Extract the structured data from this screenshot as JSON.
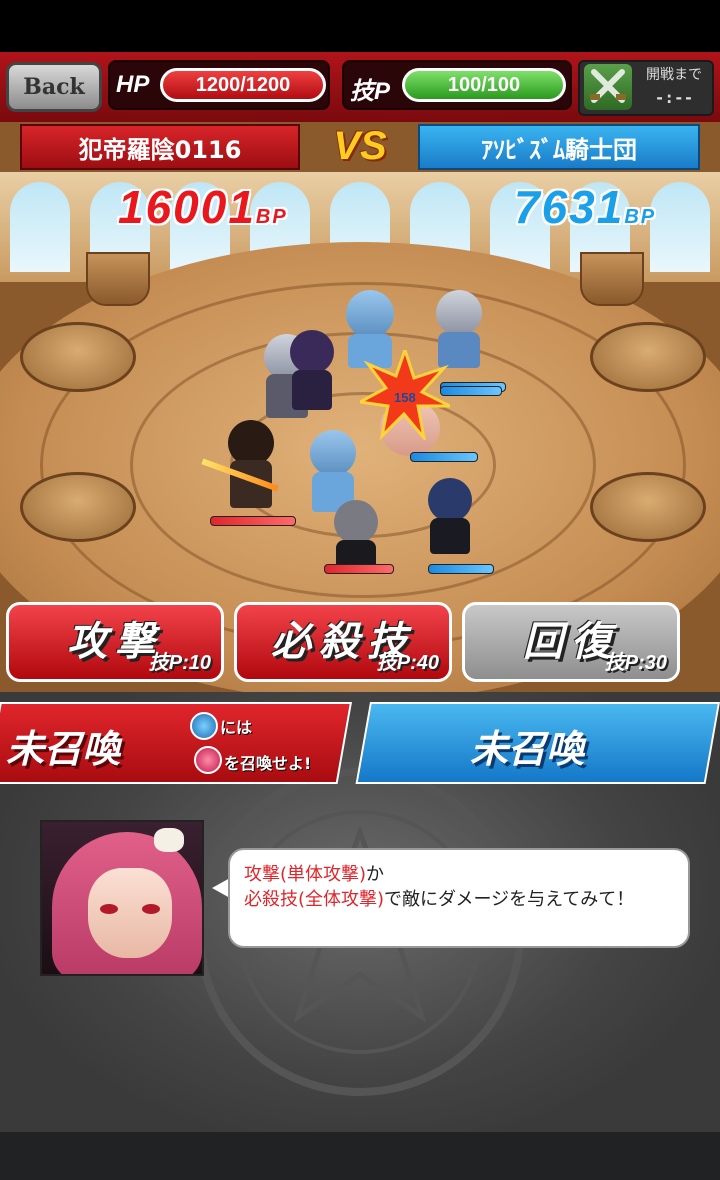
{
  "header": {
    "back_label": "Back",
    "hp_label": "HP",
    "hp_value": "1200/1200",
    "hp_fraction": 1.0,
    "sp_label": "技P",
    "sp_value": "100/100",
    "sp_fraction": 1.0,
    "battle_start_label": "開戦まで",
    "battle_start_time": "-:--"
  },
  "arena": {
    "team_left": "犯帝羅陰0116",
    "team_right": "ｱｿﾋﾞｽﾞﾑ騎士団",
    "vs_label": "VS",
    "bp_left": "16001",
    "bp_right": "7631",
    "bp_unit": "BP",
    "damage_popup": "158"
  },
  "actions": {
    "attack_label": "攻撃",
    "attack_cost": "技P:10",
    "special_label": "必殺技",
    "special_cost": "技P:40",
    "heal_label": "回復",
    "heal_cost": "技P:30"
  },
  "summon": {
    "left_label": "未召喚",
    "left_hint_line1": "には",
    "left_hint_line2": "を召喚せよ!",
    "right_label": "未召喚"
  },
  "tutorial": {
    "part1_red": "攻撃(単体攻撃)",
    "part1_rest": "か",
    "part2_red": "必殺技(全体攻撃)",
    "part2_rest": "で敵にダメージを与えてみて！"
  },
  "colors": {
    "team_left": "#d8252a",
    "team_right": "#3ab4f0",
    "hp_pill": "#e82a30",
    "sp_pill": "#4cc03a"
  }
}
